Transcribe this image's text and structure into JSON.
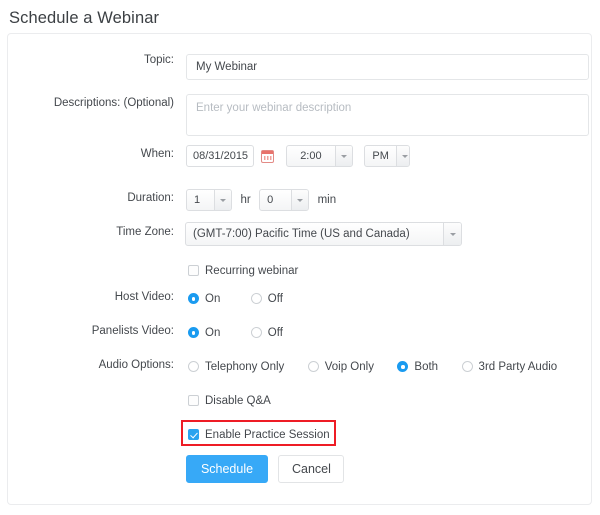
{
  "page": {
    "title": "Schedule a Webinar"
  },
  "form": {
    "topic": {
      "label": "Topic:",
      "value": "My Webinar",
      "placeholder": ""
    },
    "description": {
      "label": "Descriptions: (Optional)",
      "value": "",
      "placeholder": "Enter your webinar description"
    },
    "when": {
      "label": "When:",
      "date": "08/31/2015",
      "calendar_icon": "calendar-icon",
      "time": "2:00",
      "meridiem": "PM"
    },
    "duration": {
      "label": "Duration:",
      "hours": "1",
      "hours_unit": "hr",
      "minutes": "0",
      "minutes_unit": "min"
    },
    "timezone": {
      "label": "Time Zone:",
      "value": "(GMT-7:00) Pacific Time (US and Canada)"
    },
    "recurring": {
      "label": "Recurring webinar",
      "checked": false
    },
    "host_video": {
      "label": "Host Video:",
      "options": [
        {
          "label": "On",
          "selected": true
        },
        {
          "label": "Off",
          "selected": false
        }
      ]
    },
    "panelists_video": {
      "label": "Panelists Video:",
      "options": [
        {
          "label": "On",
          "selected": true
        },
        {
          "label": "Off",
          "selected": false
        }
      ]
    },
    "audio_options": {
      "label": "Audio Options:",
      "options": [
        {
          "label": "Telephony Only",
          "selected": false
        },
        {
          "label": "Voip Only",
          "selected": false
        },
        {
          "label": "Both",
          "selected": true
        },
        {
          "label": "3rd Party Audio",
          "selected": false
        }
      ]
    },
    "disable_qa": {
      "label": "Disable Q&A",
      "checked": false
    },
    "practice_session": {
      "label": "Enable Practice Session",
      "checked": true,
      "highlighted": true
    }
  },
  "actions": {
    "submit_label": "Schedule",
    "cancel_label": "Cancel"
  },
  "colors": {
    "accent": "#37a9f7",
    "highlight": "#ee1c25",
    "calendar_icon": "#e8736c"
  }
}
